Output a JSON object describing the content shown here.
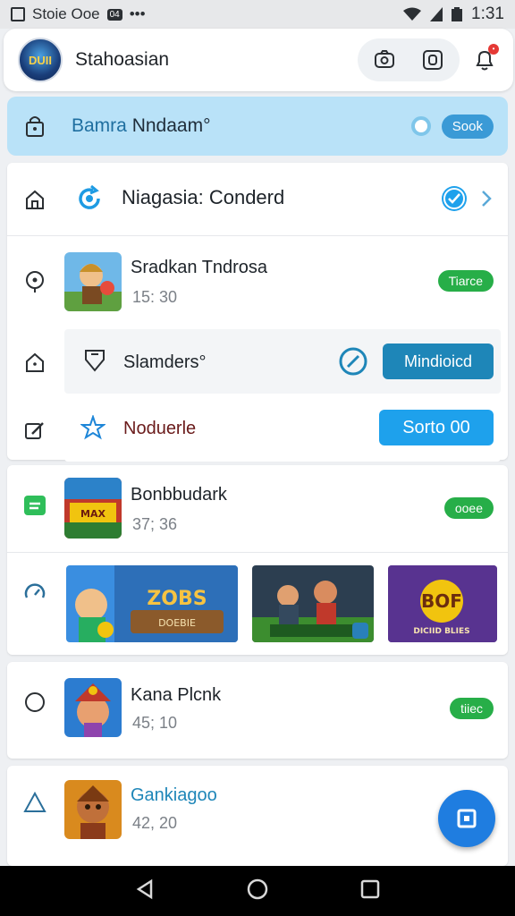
{
  "status_bar": {
    "app_text": "Stoie Ooe",
    "badge": "04",
    "dots": "•••",
    "time": "1:31"
  },
  "header": {
    "avatar_text": "DUII",
    "title": "Stahoasian"
  },
  "banner": {
    "title_a": "Bamra",
    "title_b": " Nndaam",
    "mark": "°",
    "button": "Sook"
  },
  "section_row": {
    "title": "Niagasia: Conderd"
  },
  "game1": {
    "title": "Sradkan Tndrosa",
    "sub": "15: 30",
    "badge": "Tiarce"
  },
  "sub_items": [
    {
      "label": "Slamders",
      "mark": "°",
      "button": "Mindioicd"
    },
    {
      "label": "Noduerle",
      "button": "Sorto 00"
    }
  ],
  "game2": {
    "title": "Bonbbudark",
    "sub": "37; 36",
    "badge": "ooee"
  },
  "banners": [
    {
      "text": "ZOBS",
      "sub": "DOEBIE"
    },
    {
      "text": "",
      "sub": ""
    },
    {
      "text": "BOF",
      "sub": "DICIID BLIES"
    }
  ],
  "game3": {
    "title": "Kana Plcnk",
    "sub": "45; 10",
    "badge": "tiiec"
  },
  "game4": {
    "title": "Gankiagoo",
    "sub": "42, 20"
  },
  "colors": {
    "accent": "#1ea1ec",
    "success": "#27ae48",
    "banner_bg": "#b9e2f8"
  }
}
